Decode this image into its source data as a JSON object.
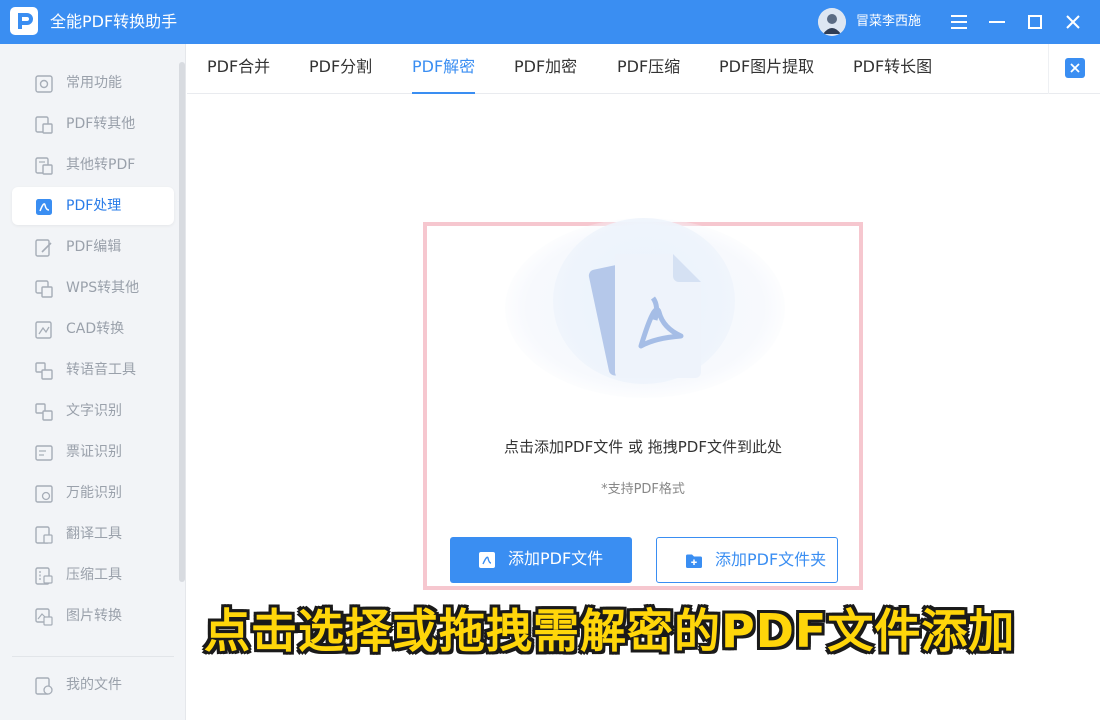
{
  "app": {
    "title": "全能PDF转换助手",
    "user_name": "冒菜李西施"
  },
  "sidebar": {
    "items": [
      {
        "label": "常用功能",
        "icon": "common-functions-icon"
      },
      {
        "label": "PDF转其他",
        "icon": "pdf-to-other-icon"
      },
      {
        "label": "其他转PDF",
        "icon": "other-to-pdf-icon"
      },
      {
        "label": "PDF处理",
        "icon": "pdf-process-icon",
        "active": true
      },
      {
        "label": "PDF编辑",
        "icon": "pdf-edit-icon"
      },
      {
        "label": "WPS转其他",
        "icon": "wps-convert-icon"
      },
      {
        "label": "CAD转换",
        "icon": "cad-convert-icon"
      },
      {
        "label": "转语音工具",
        "icon": "text-to-speech-icon"
      },
      {
        "label": "文字识别",
        "icon": "ocr-icon"
      },
      {
        "label": "票证识别",
        "icon": "ticket-recognition-icon"
      },
      {
        "label": "万能识别",
        "icon": "universal-recognition-icon"
      },
      {
        "label": "翻译工具",
        "icon": "translate-icon"
      },
      {
        "label": "压缩工具",
        "icon": "compress-icon"
      },
      {
        "label": "图片转换",
        "icon": "image-convert-icon"
      }
    ],
    "bottom_item": {
      "label": "我的文件",
      "icon": "my-files-icon"
    }
  },
  "tabs": [
    {
      "label": "PDF合并"
    },
    {
      "label": "PDF分割"
    },
    {
      "label": "PDF解密",
      "active": true
    },
    {
      "label": "PDF加密"
    },
    {
      "label": "PDF压缩"
    },
    {
      "label": "PDF图片提取"
    },
    {
      "label": "PDF转长图"
    }
  ],
  "dropzone": {
    "hint": "点击添加PDF文件 或 拖拽PDF文件到此处",
    "format_note": "*支持PDF格式",
    "add_file_label": "添加PDF文件",
    "add_folder_label": "添加PDF文件夹"
  },
  "caption": "点击选择或拖拽需解密的PDF文件添加",
  "colors": {
    "accent": "#3a8ef2",
    "highlight_border": "#f6c7cf",
    "caption": "#ffd60a"
  }
}
